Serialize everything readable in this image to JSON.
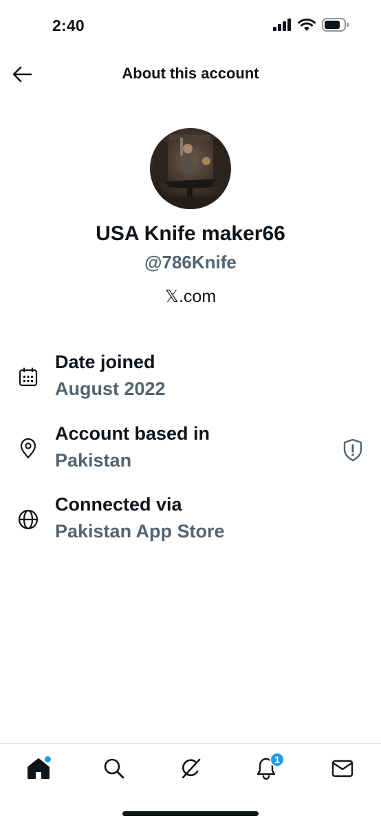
{
  "status_bar": {
    "time": "2:40",
    "icons": [
      "signal-icon",
      "wifi-icon",
      "battery-icon"
    ]
  },
  "header": {
    "title": "About this account",
    "back_icon": "arrow-left-icon"
  },
  "profile": {
    "display_name": "USA Knife maker66",
    "handle": "@786Knife",
    "source": "𝕏.com"
  },
  "details": [
    {
      "icon": "calendar-icon",
      "label": "Date joined",
      "value": "August 2022"
    },
    {
      "icon": "location-pin-icon",
      "label": "Account based in",
      "value": "Pakistan",
      "trailing_icon": "shield-alert-icon"
    },
    {
      "icon": "globe-icon",
      "label": "Connected via",
      "value": "Pakistan App Store"
    }
  ],
  "tab_bar": {
    "tabs": [
      {
        "name": "home-icon",
        "active": true,
        "has_dot": true
      },
      {
        "name": "search-icon"
      },
      {
        "name": "grok-icon"
      },
      {
        "name": "bell-icon",
        "badge": "1"
      },
      {
        "name": "mail-icon"
      }
    ]
  },
  "colors": {
    "text": "#0f1419",
    "secondary": "#536471",
    "accent": "#1d9bf0"
  }
}
